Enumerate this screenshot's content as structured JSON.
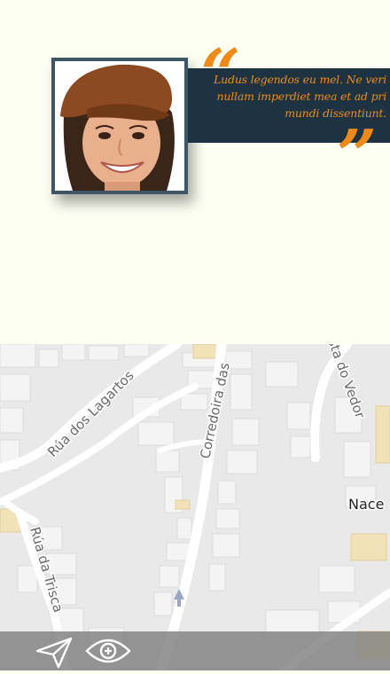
{
  "testimonial": {
    "quote": "Ludus legendos eu mel. Ne veri nullam imperdiet mea et ad pri mundi dissentiunt.",
    "photo_alt": "Smiling woman in a brown cap",
    "colors": {
      "quote_bg": "#1e3342",
      "quote_text": "#f08a1a",
      "frame": "#3e5566",
      "page_bg": "#fdfff3"
    }
  },
  "map": {
    "street_labels": [
      "Rúa dos Lagartos",
      "Corredoira das",
      "Rúa da Trisca",
      "sta do Vedor"
    ],
    "place_label": "Nace"
  },
  "toolbar": {
    "send_icon": "paper-plane-icon",
    "view_icon": "eye-plus-icon"
  }
}
